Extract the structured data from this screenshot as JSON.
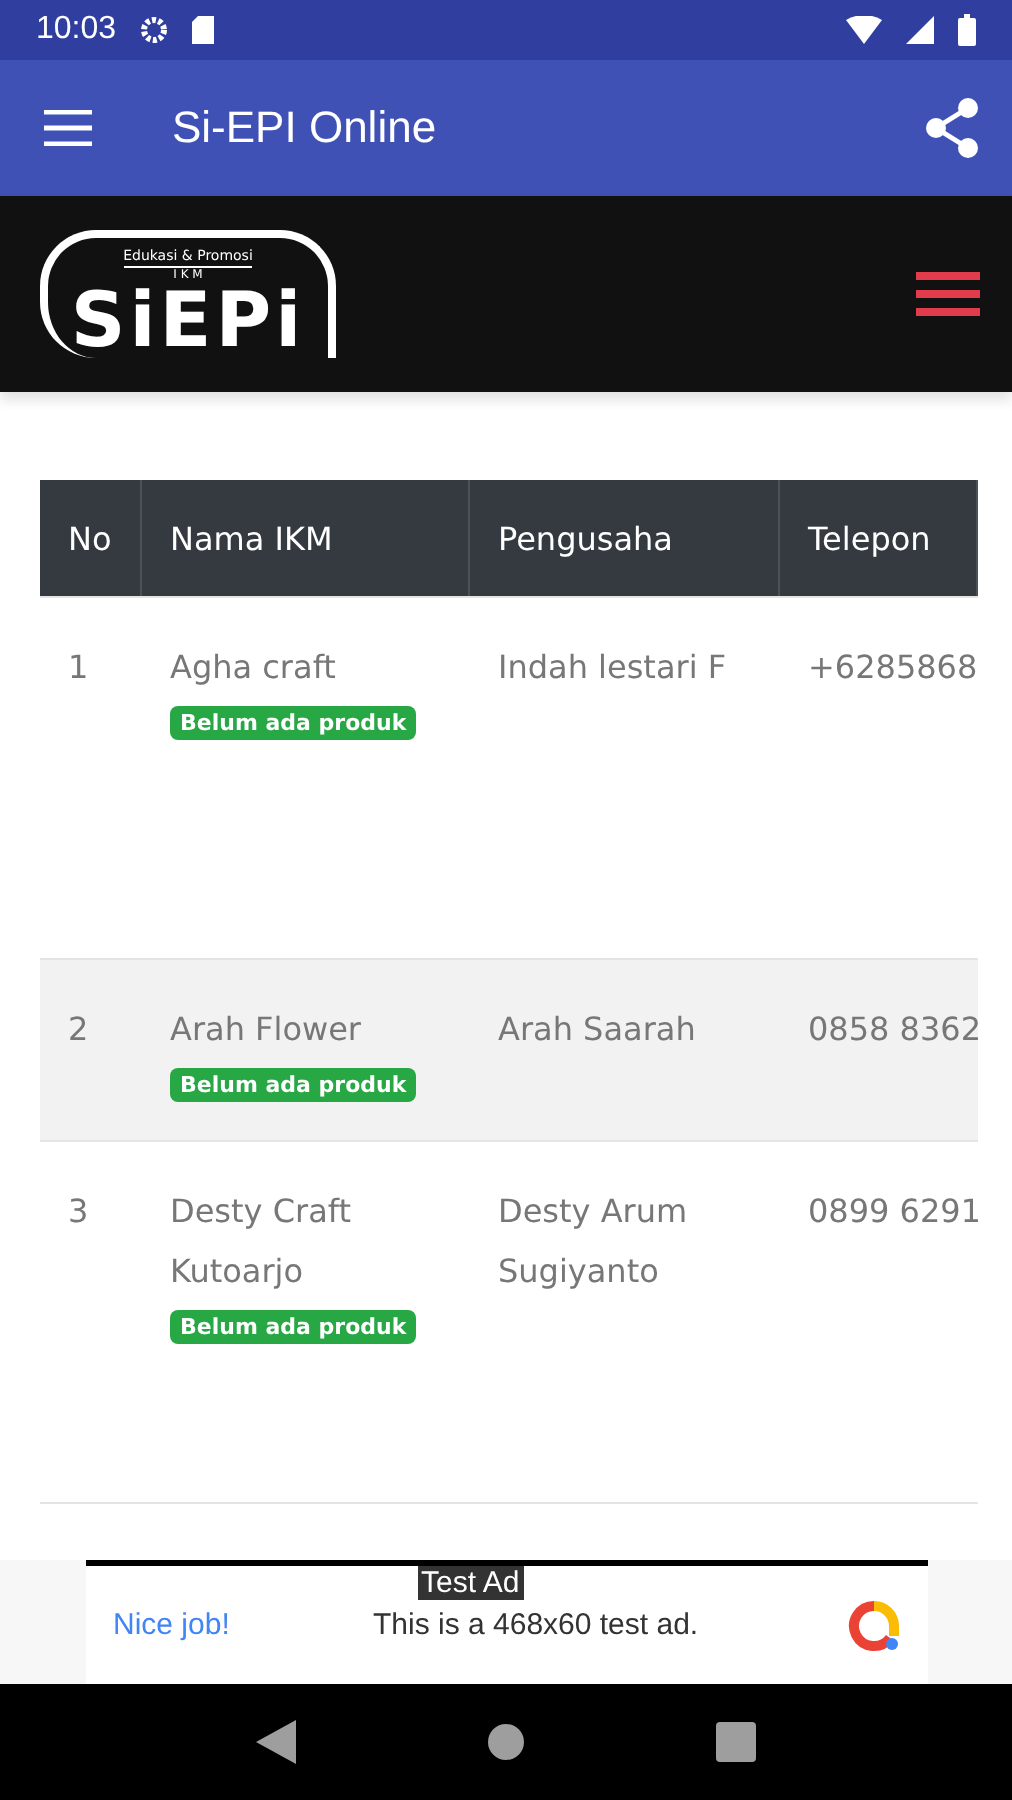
{
  "status_bar": {
    "time": "10:03"
  },
  "app_bar": {
    "title": "Si-EPI Online"
  },
  "site_header": {
    "logo": {
      "text": "SiEPi",
      "tagline": "Edukasi & Promosi",
      "sub": "I K M"
    }
  },
  "table": {
    "columns": [
      "No",
      "Nama IKM",
      "Pengusaha",
      "Telepon"
    ],
    "rows": [
      {
        "no": "1",
        "name": "Agha craft",
        "badge": "Belum ada produk",
        "owner": "Indah lestari F",
        "phone": "+6285868",
        "striped": false,
        "tall": true
      },
      {
        "no": "2",
        "name": "Arah Flower",
        "badge": "Belum ada produk",
        "owner": "Arah Saarah",
        "phone": "0858 8362",
        "striped": true,
        "tall": false
      },
      {
        "no": "3",
        "name": "Desty Craft Kutoarjo",
        "badge": "Belum ada produk",
        "owner": "Desty Arum Sugiyanto",
        "phone": "0899 6291",
        "striped": false,
        "tall": true
      }
    ]
  },
  "ad": {
    "label": "Test Ad",
    "headline": "Nice job!",
    "text": "This is a 468x60 test ad."
  }
}
